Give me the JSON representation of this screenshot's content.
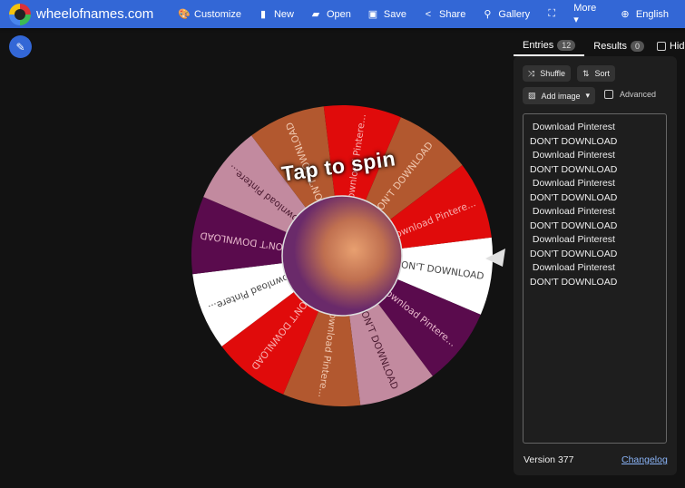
{
  "header": {
    "site": "wheelofnames.com",
    "nav": [
      {
        "label": "Customize",
        "icon": "palette-icon",
        "glyph": "🎨"
      },
      {
        "label": "New",
        "icon": "file-icon",
        "glyph": "▮"
      },
      {
        "label": "Open",
        "icon": "folder-open-icon",
        "glyph": "▰"
      },
      {
        "label": "Save",
        "icon": "save-icon",
        "glyph": "▣"
      },
      {
        "label": "Share",
        "icon": "share-icon",
        "glyph": "<"
      },
      {
        "label": "Gallery",
        "icon": "search-icon",
        "glyph": "⚲"
      },
      {
        "label": "",
        "icon": "fullscreen-icon",
        "glyph": "⛶"
      },
      {
        "label": "More ▾",
        "icon": "",
        "glyph": ""
      },
      {
        "label": "English",
        "icon": "globe-icon",
        "glyph": "⊕"
      }
    ]
  },
  "wheel": {
    "tap_label": "Tap to spin",
    "segments": [
      {
        "label": "DON'T DOWNLOAD",
        "color": "#ffffff",
        "text_color": "#444444"
      },
      {
        "label": "Download Pintere...",
        "color": "#5a0b4d",
        "text_color": "#e8b8cc"
      },
      {
        "label": "DON'T DOWNLOAD",
        "color": "#c28a9f",
        "text_color": "#4a1a30"
      },
      {
        "label": "Download Pintere...",
        "color": "#b2582f",
        "text_color": "#f0c8b0"
      },
      {
        "label": "DON'T DOWNLOAD",
        "color": "#e00b0b",
        "text_color": "#f7b0b0"
      },
      {
        "label": "Download Pintere...",
        "color": "#ffffff",
        "text_color": "#444444"
      },
      {
        "label": "DON'T DOWNLOAD",
        "color": "#5a0b4d",
        "text_color": "#e8b8cc"
      },
      {
        "label": "Download Pintere...",
        "color": "#c28a9f",
        "text_color": "#4a1a30"
      },
      {
        "label": "DON'T DOWNLOAD",
        "color": "#b2582f",
        "text_color": "#f0c8b0"
      },
      {
        "label": "Download Pintere...",
        "color": "#e00b0b",
        "text_color": "#f7b0b0"
      },
      {
        "label": "DON'T DOWNLOAD",
        "color": "#b2582f",
        "text_color": "#f0c8b0"
      },
      {
        "label": "Download Pintere...",
        "color": "#e00b0b",
        "text_color": "#f7b0b0"
      }
    ]
  },
  "panel": {
    "tabs": [
      {
        "label": "Entries",
        "count": "12"
      },
      {
        "label": "Results",
        "count": "0"
      }
    ],
    "hide_label": "Hid",
    "shuffle": "Shuffle",
    "sort": "Sort",
    "add_image": "Add image",
    "advanced": "Advanced",
    "entries_text": " Download Pinterest\nDON'T DOWNLOAD\n Download Pinterest\nDON'T DOWNLOAD\n Download Pinterest\nDON'T DOWNLOAD\n Download Pinterest\nDON'T DOWNLOAD\n Download Pinterest\nDON'T DOWNLOAD\n Download Pinterest\nDON'T DOWNLOAD",
    "version": "Version 377",
    "changelog": "Changelog"
  }
}
